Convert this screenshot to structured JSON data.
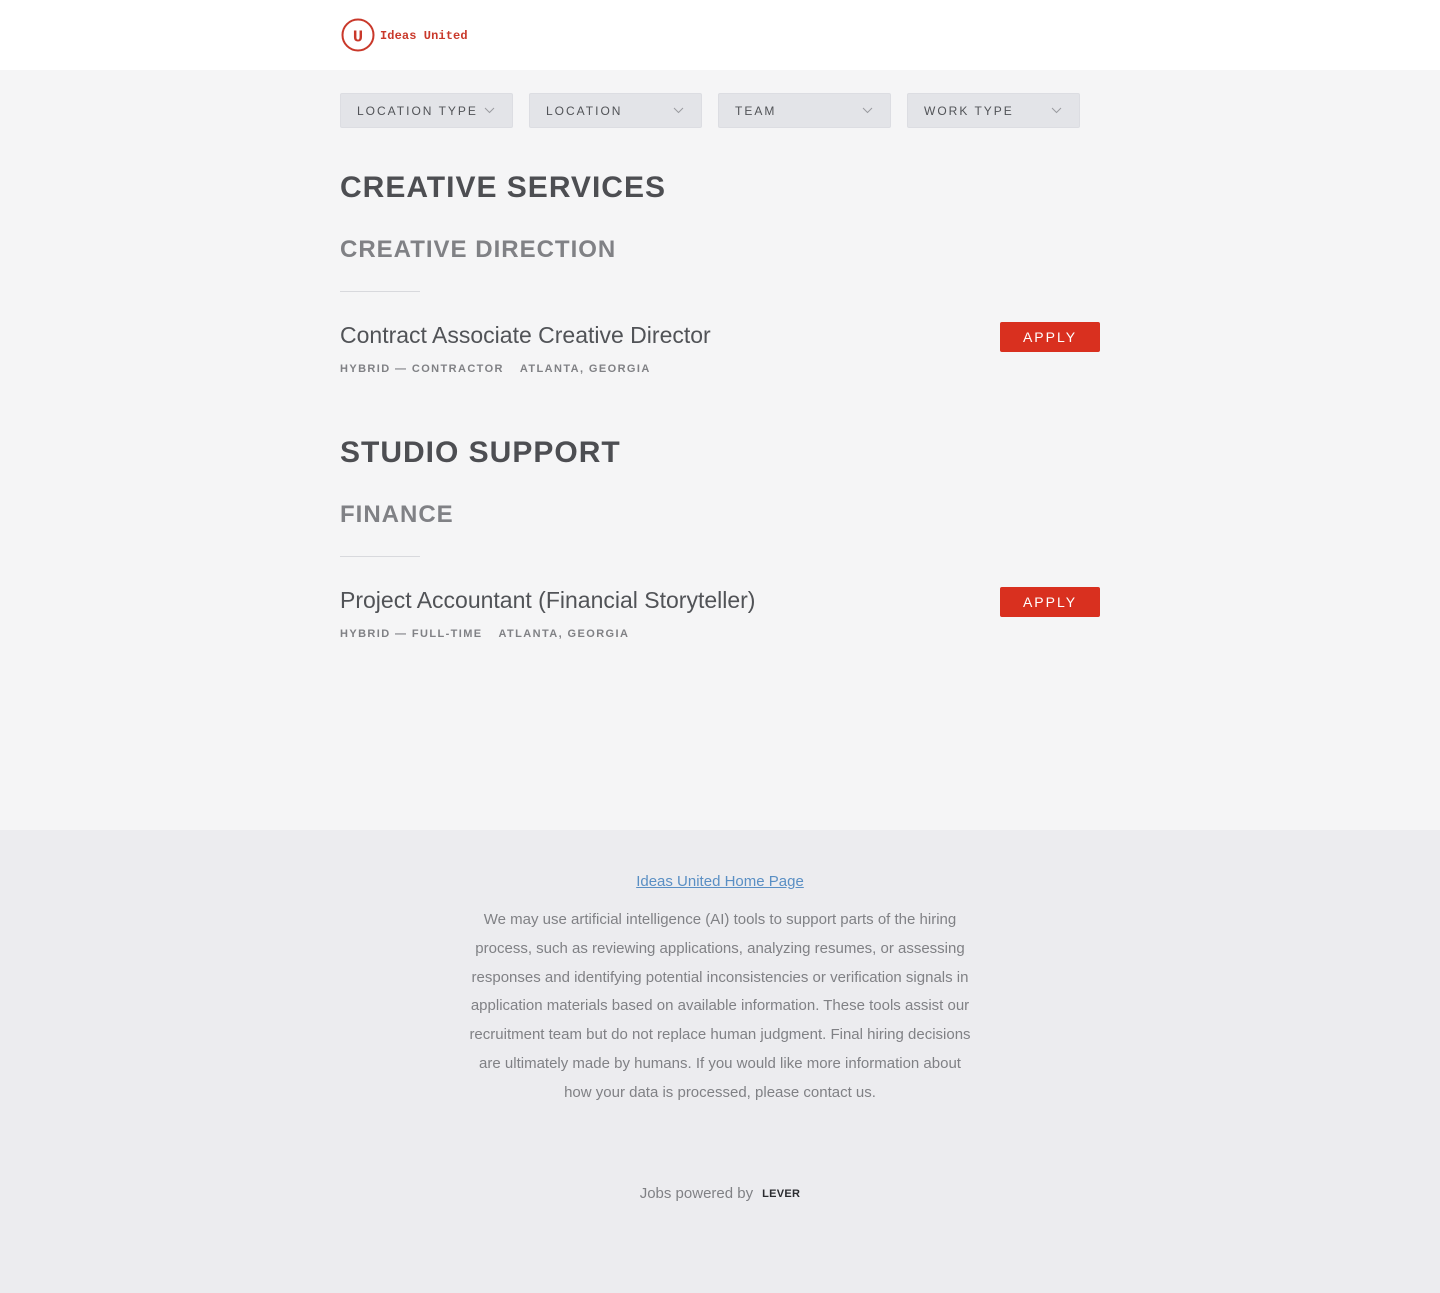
{
  "brand": {
    "name": "Ideas United",
    "mark_letter": "U",
    "color": "#c9382a"
  },
  "filters": [
    {
      "label": "LOCATION TYPE"
    },
    {
      "label": "LOCATION"
    },
    {
      "label": "TEAM"
    },
    {
      "label": "WORK TYPE"
    }
  ],
  "groups": [
    {
      "title": "CREATIVE SERVICES",
      "subteam": "CREATIVE DIRECTION",
      "postings": [
        {
          "title": "Contract Associate Creative Director",
          "commitment": "HYBRID — CONTRACTOR",
          "location": "ATLANTA, GEORGIA",
          "apply_label": "APPLY"
        }
      ]
    },
    {
      "title": "STUDIO SUPPORT",
      "subteam": "FINANCE",
      "postings": [
        {
          "title": "Project Accountant (Financial Storyteller)",
          "commitment": "HYBRID — FULL-TIME",
          "location": "ATLANTA, GEORGIA",
          "apply_label": "APPLY"
        }
      ]
    }
  ],
  "footer": {
    "home_link": "Ideas United Home Page",
    "disclaimer": "We may use artificial intelligence (AI) tools to support parts of the hiring process, such as reviewing applications, analyzing resumes, or assessing responses and identifying potential inconsistencies or verification signals in application materials based on available information. These tools assist our recruitment team but do not replace human judgment. Final hiring decisions are ultimately made by humans. If you would like more information about how your data is processed, please contact us.",
    "powered_by": "Jobs powered by",
    "provider": "LEVER"
  },
  "colors": {
    "accent": "#d9301f",
    "link": "#5a8fc4",
    "page_bg": "#f5f5f6",
    "footer_bg": "#ececef"
  }
}
